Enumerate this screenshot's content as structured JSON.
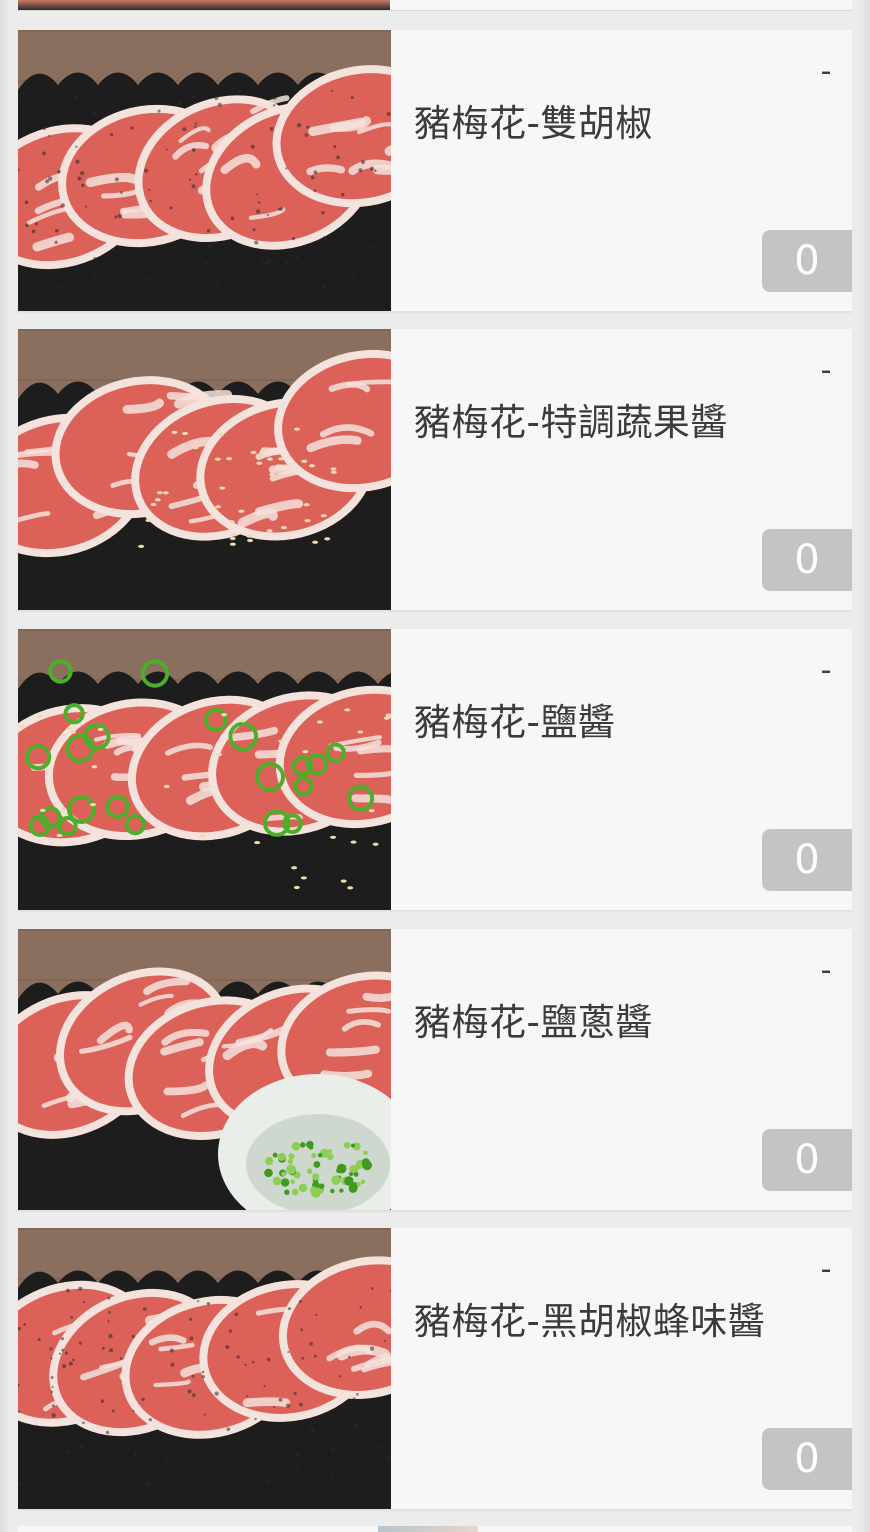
{
  "items": [
    {
      "name": "豬梅花-雙胡椒",
      "minus_label": "-",
      "quantity": "0",
      "photo": "pork-collar-double-pepper",
      "garnish": "pepper"
    },
    {
      "name": "豬梅花-特調蔬果醬",
      "minus_label": "-",
      "quantity": "0",
      "photo": "pork-collar-fruit-sauce",
      "garnish": "sesame"
    },
    {
      "name": "豬梅花-鹽醬",
      "minus_label": "-",
      "quantity": "0",
      "photo": "pork-collar-salt-sauce",
      "garnish": "scallion"
    },
    {
      "name": "豬梅花-鹽蔥醬",
      "minus_label": "-",
      "quantity": "0",
      "photo": "pork-collar-salt-scallion-sauce",
      "garnish": "bowl"
    },
    {
      "name": "豬梅花-黑胡椒蜂味醬",
      "minus_label": "-",
      "quantity": "0",
      "photo": "pork-collar-black-pepper-honey-sauce",
      "garnish": "pepper"
    }
  ],
  "colors": {
    "page_background": "#ececec",
    "card_background": "#f7f7f7",
    "title_text": "#3b3b3b",
    "qty_badge": "#c4c4c4",
    "qty_text": "#ffffff",
    "meat_red": "#d9524a",
    "meat_fat": "#f4e3dc",
    "tray_black": "#1d1d1d",
    "wood": "#8a6f5e"
  }
}
